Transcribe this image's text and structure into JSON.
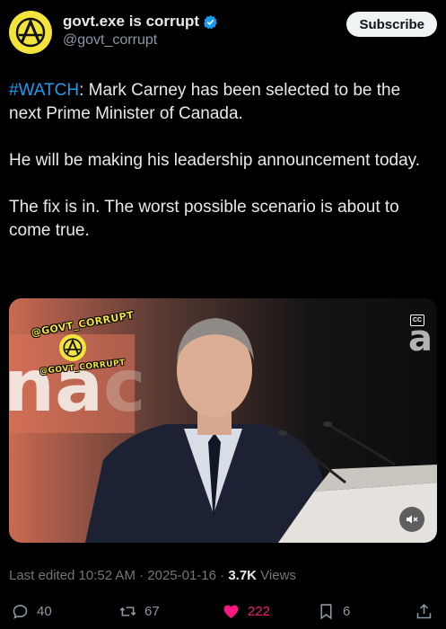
{
  "author": {
    "display_name": "govt.exe is corrupt",
    "handle": "@govt_corrupt",
    "verified": true
  },
  "subscribe_label": "Subscribe",
  "tweet": {
    "hashtag": "#WATCH",
    "line1_rest": ": Mark Carney has been selected to be the next Prime Minister of Canada.",
    "paragraph2": "He will be making his leadership announcement today.",
    "paragraph3": "The fix is in. The worst possible scenario is about to come true."
  },
  "media": {
    "watermark_top": "@GOVT_CORRUPT",
    "watermark_bottom": "@GOVT_CORRUPT",
    "cc_icon": "cc-icon",
    "mute_icon": "mute-icon"
  },
  "meta": {
    "edited_prefix": "Last edited 10:52 AM · 2025-01-16 · ",
    "views_count": "3.7K",
    "views_label": " Views"
  },
  "actions": {
    "replies": "40",
    "reposts": "67",
    "likes": "222",
    "bookmarks": "6"
  },
  "colors": {
    "accent": "#1d9bf0",
    "like": "#f91880",
    "avatar_bg": "#f2e43a"
  }
}
